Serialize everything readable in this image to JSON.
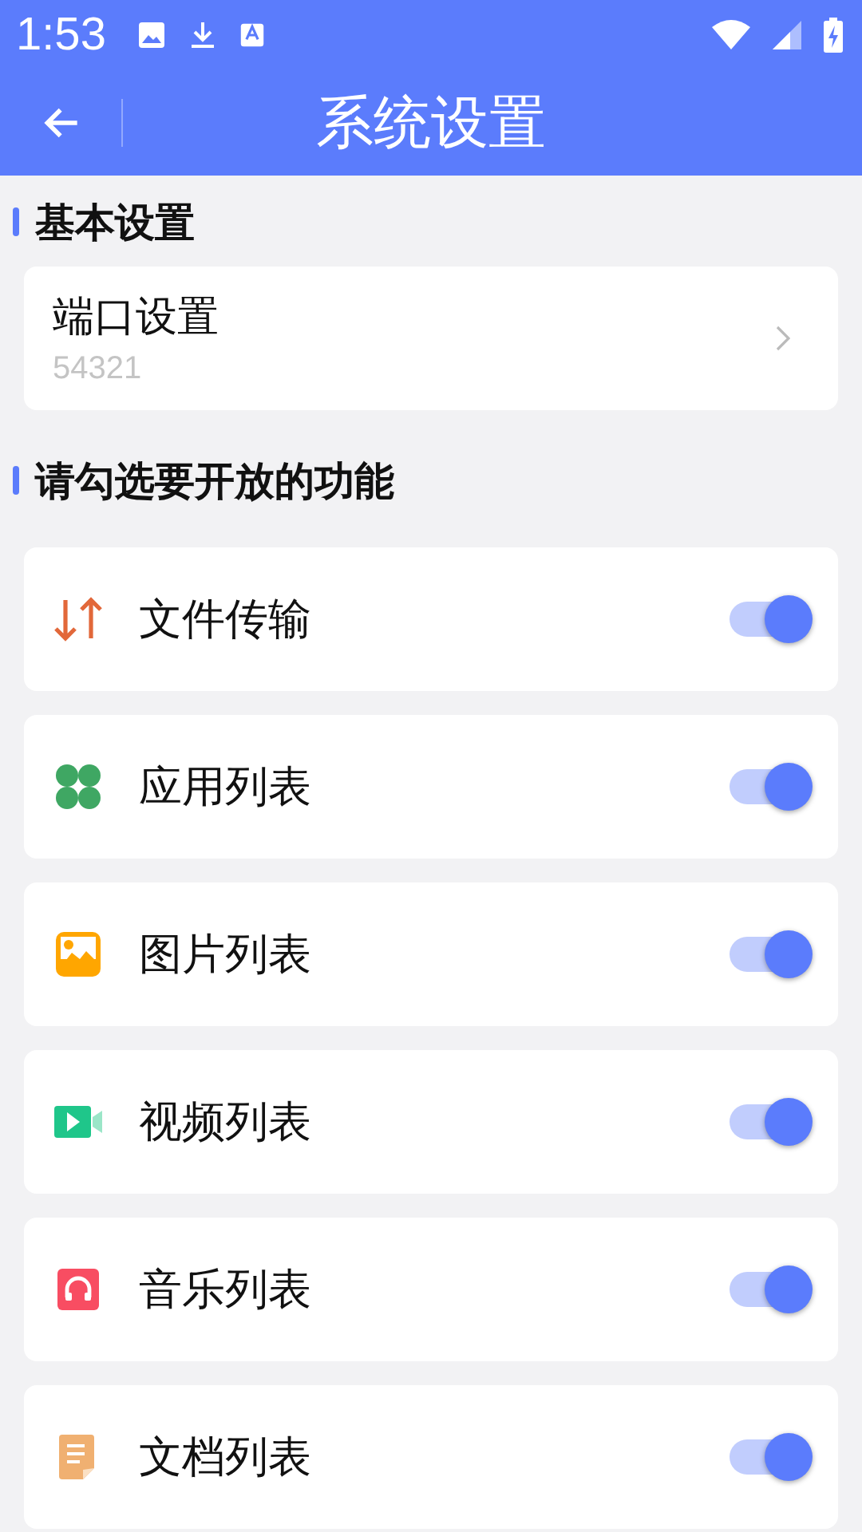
{
  "status_bar": {
    "time": "1:53"
  },
  "app_bar": {
    "title": "系统设置"
  },
  "sections": [
    {
      "title": "基本设置",
      "items": [
        {
          "kind": "link",
          "label": "端口设置",
          "value": "54321"
        }
      ]
    },
    {
      "title": "请勾选要开放的功能",
      "items": [
        {
          "kind": "transfer",
          "label": "文件传输",
          "on": true
        },
        {
          "kind": "apps",
          "label": "应用列表",
          "on": true
        },
        {
          "kind": "images",
          "label": "图片列表",
          "on": true
        },
        {
          "kind": "video",
          "label": "视频列表",
          "on": true
        },
        {
          "kind": "music",
          "label": "音乐列表",
          "on": true
        },
        {
          "kind": "docs",
          "label": "文档列表",
          "on": true
        }
      ]
    }
  ]
}
